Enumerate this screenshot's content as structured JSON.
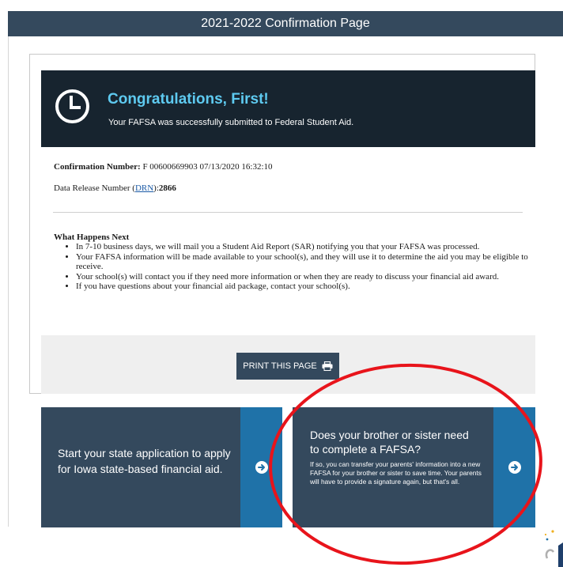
{
  "header": {
    "title": "2021-2022 Confirmation Page"
  },
  "banner": {
    "title": "Congratulations, First!",
    "subtitle": "Your FAFSA was successfully submitted to Federal Student Aid."
  },
  "confirmation": {
    "label": "Confirmation Number:",
    "value": "F 00600669903 07/13/2020 16:32:10"
  },
  "drn": {
    "label_prefix": "Data Release Number (",
    "link_text": "DRN",
    "label_suffix": "):",
    "value": "2866"
  },
  "what_next": {
    "title": "What Happens Next",
    "items": [
      "In 7-10 business days, we will mail you a Student Aid Report (SAR) notifying you that your FAFSA was processed.",
      "Your FAFSA information will be made available to your school(s), and they will use it to determine the aid you may be eligible to receive.",
      "Your school(s) will contact you if they need more information or when they are ready to discuss your financial aid award.",
      "If you have questions about your financial aid package, contact your school(s)."
    ]
  },
  "print_button": {
    "label": "PRINT THIS PAGE"
  },
  "tile_state": {
    "text": "Start your state application to apply for Iowa state-based financial aid."
  },
  "tile_sibling": {
    "heading": "Does your brother or sister need to complete a FAFSA?",
    "body": "If so, you can transfer your parents' information into a new FAFSA for your brother or sister to save time. Your parents will have to provide a signature again, but that's all."
  },
  "colors": {
    "header_bg": "#34495d",
    "banner_bg": "#17242f",
    "banner_title": "#5ecaf0",
    "tile_bg": "#34495d",
    "tile_strip": "#1f72a8",
    "annotation_red": "#e8141b"
  },
  "icons": {
    "clock": "clock-icon",
    "printer": "printer-icon",
    "arrow": "arrow-right-circle-icon"
  }
}
